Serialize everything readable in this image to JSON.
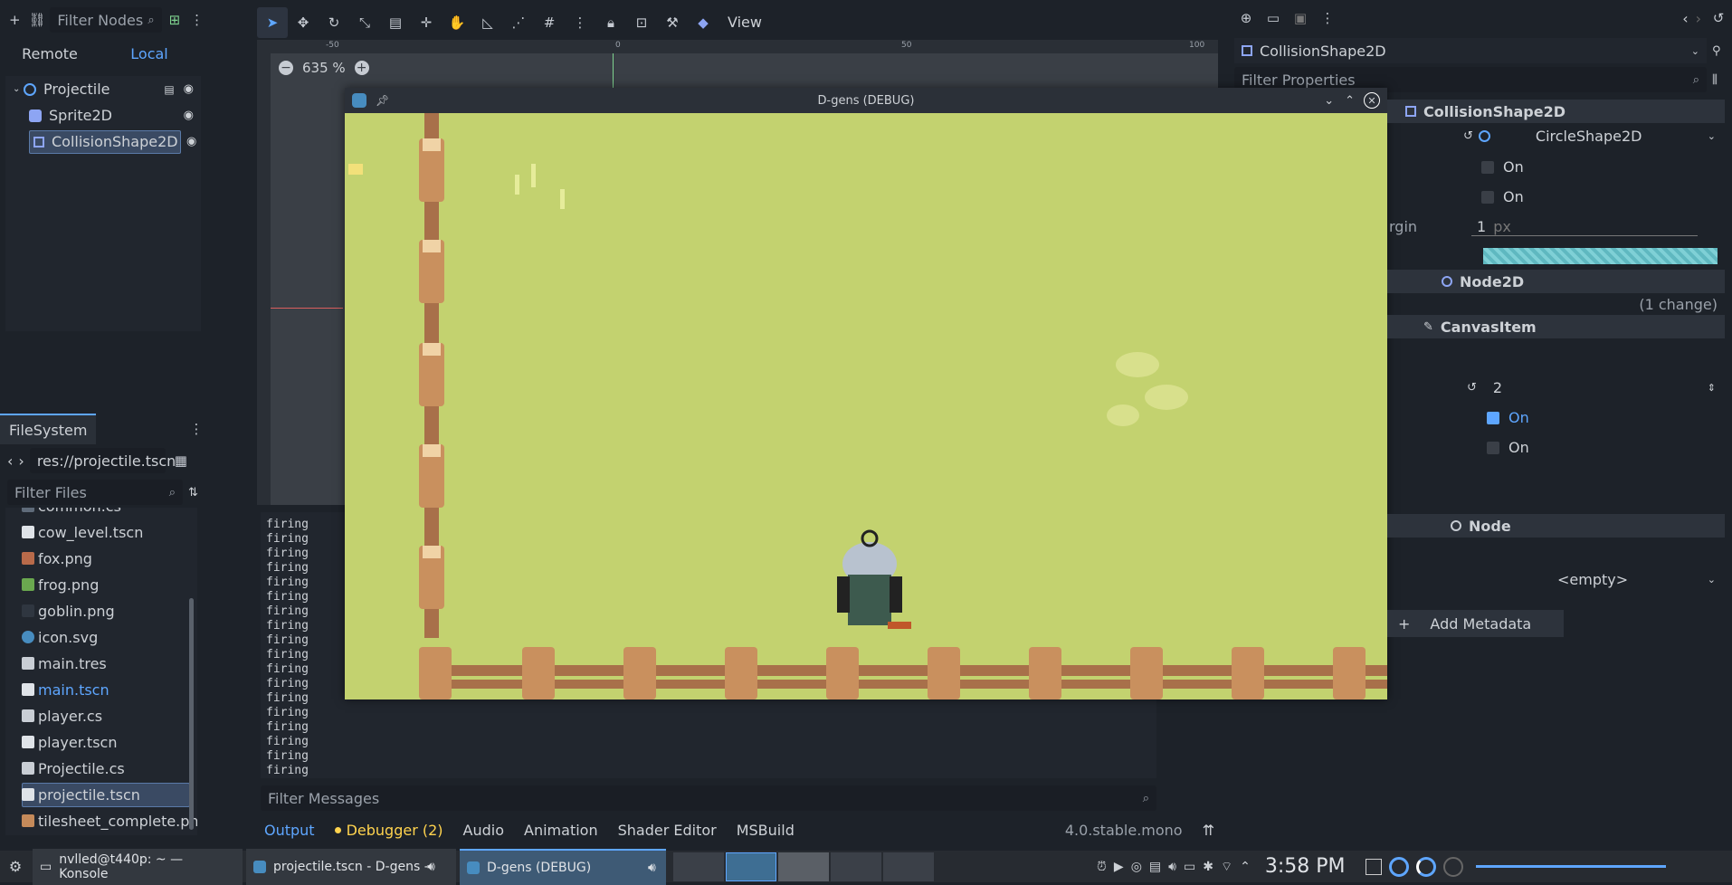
{
  "scene_dock": {
    "filter_placeholder": "Filter Nodes",
    "remote_tab": "Remote",
    "local_tab": "Local",
    "nodes": [
      {
        "label": "Projectile",
        "icon": "node2d-icon"
      },
      {
        "label": "Sprite2D",
        "icon": "sprite-icon"
      },
      {
        "label": "CollisionShape2D",
        "icon": "collision-shape-icon"
      }
    ]
  },
  "filesystem": {
    "tab": "FileSystem",
    "path": "res://projectile.tscn",
    "filter_placeholder": "Filter Files",
    "files": [
      "common.cs",
      "cow_level.tscn",
      "fox.png",
      "frog.png",
      "goblin.png",
      "icon.svg",
      "main.tres",
      "main.tscn",
      "player.cs",
      "player.tscn",
      "Projectile.cs",
      "projectile.tscn",
      "tilesheet_complete.png"
    ]
  },
  "toolbar": {
    "view_menu": "View"
  },
  "viewport": {
    "zoom": "635 %",
    "ruler": [
      "-50",
      "0",
      "50",
      "100"
    ]
  },
  "game_window": {
    "title": "D-gens (DEBUG)"
  },
  "output": {
    "lines": [
      "firing",
      "firing",
      "firing",
      "firing",
      "firing",
      "firing",
      "firing",
      "firing",
      "firing",
      "firing",
      "firing",
      "firing",
      "firing",
      "firing",
      "firing",
      "firing",
      "firing",
      "firing"
    ],
    "filter_placeholder": "Filter Messages",
    "tabs": [
      "Output",
      "Debugger (2)",
      "Audio",
      "Animation",
      "Shader Editor",
      "MSBuild"
    ],
    "version": "4.0.stable.mono"
  },
  "inspector": {
    "node_selector": "CollisionShape2D",
    "filter_placeholder": "Filter Properties",
    "header_collision": "CollisionShape2D",
    "shape_value": "CircleShape2D",
    "on1": "On",
    "on2": "On",
    "margin_label": "rgin",
    "margin_value": "1",
    "margin_unit": "px",
    "header_node2d": "Node2D",
    "change_note": "(1 change)",
    "header_canvas": "CanvasItem",
    "layer_value": "2",
    "on3": "On",
    "on4": "On",
    "header_node": "Node",
    "meta_value": "<empty>",
    "add_metadata": "Add Metadata"
  },
  "taskbar": {
    "apps": [
      "nvlled@t440p: ~ — Konsole",
      "projectile.tscn - D-gens - G...",
      "D-gens (DEBUG)"
    ],
    "clock": "3:58 PM"
  },
  "colors": {
    "accent": "#5ea6ff",
    "grass": "#c3d26f",
    "debugger_dot": "#ffd34e"
  }
}
